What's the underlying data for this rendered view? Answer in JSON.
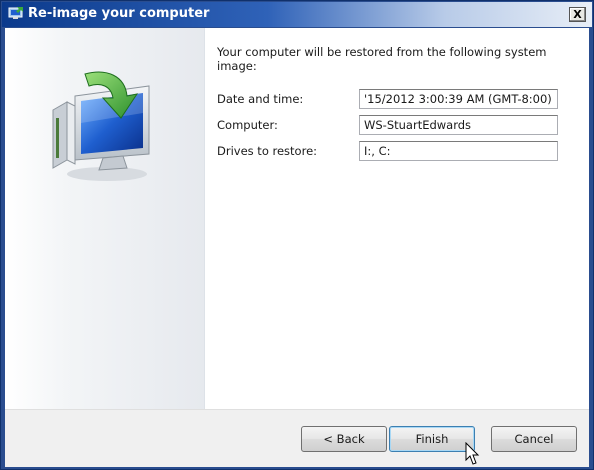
{
  "window": {
    "title": "Re-image your computer",
    "close_glyph": "X"
  },
  "main": {
    "intro": "Your computer will be restored from the following system image:",
    "fields": [
      {
        "label": "Date and time:",
        "value": "'15/2012 3:00:39 AM (GMT-8:00)"
      },
      {
        "label": "Computer:",
        "value": "WS-StuartEdwards"
      },
      {
        "label": "Drives to restore:",
        "value": "I:, C:"
      }
    ]
  },
  "footer": {
    "back_label": "< Back",
    "finish_label": "Finish",
    "cancel_label": "Cancel"
  },
  "icons": {
    "title_icon": "computer-restore-icon",
    "hero_icon": "computer-restore-arrow-icon",
    "cursor": "mouse-pointer-icon"
  },
  "colors": {
    "titlebar_start": "#0b3a8c",
    "arrow_green": "#3caa3c",
    "screen_blue": "#1f5fcf"
  }
}
